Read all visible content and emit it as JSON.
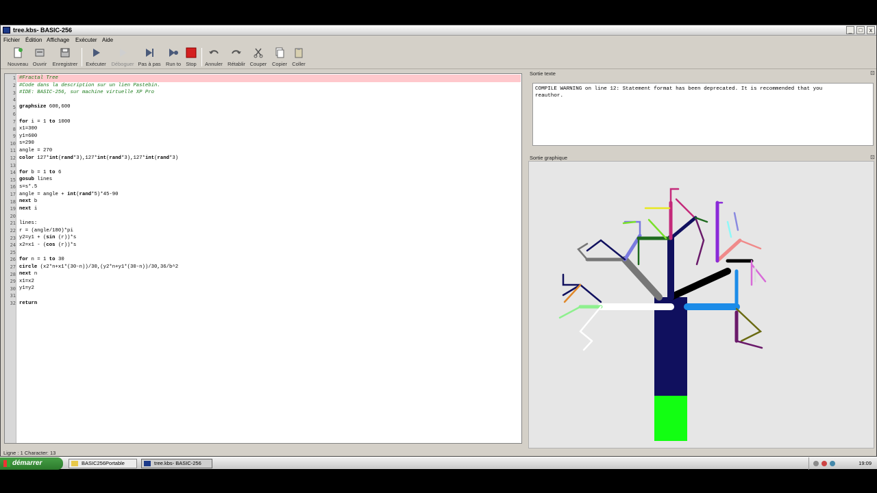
{
  "window": {
    "title": "tree.kbs- BASIC-256",
    "controls": {
      "minimize": "_",
      "maximize": "□",
      "close": "x"
    }
  },
  "menu": [
    "Fichier",
    "Édition",
    "Affichage",
    "Exécuter",
    "Aide"
  ],
  "toolbar": {
    "new": "Nouveau",
    "open": "Ouvrir",
    "save": "Enregistrer",
    "run": "Exécuter",
    "debug": "Déboguer",
    "step": "Pas à pas",
    "run_to": "Run to",
    "stop": "Stop",
    "undo": "Annuler",
    "redo": "Rétablir",
    "cut": "Couper",
    "copy": "Copier",
    "paste": "Coller"
  },
  "editor": {
    "line_numbers": [
      "1",
      "2",
      "3",
      "4",
      "5",
      "6",
      "7",
      "8",
      "9",
      "10",
      "11",
      "12",
      "13",
      "14",
      "15",
      "16",
      "17",
      "18",
      "19",
      "20",
      "21",
      "22",
      "23",
      "24",
      "25",
      "26",
      "27",
      "28",
      "29",
      "30",
      "31",
      "32"
    ]
  },
  "panels": {
    "text_output_title": "Sortie texte",
    "graphics_output_title": "Sortie graphique",
    "float_icon": "⊡",
    "text_output": "COMPILE WARNING on line 12: Statement format has been deprecated. It is recommended that you\nreauthor."
  },
  "status": "Ligne : 1 Character: 13",
  "taskbar": {
    "start": "démarrer",
    "tasks": [
      "BASIC256Portable",
      "tree.kbs- BASIC-256"
    ],
    "clock": "19:09"
  },
  "colors": {
    "line_highlight": "#ffc8cc",
    "comment": "#1a7a1a",
    "stop_button": "#d42020"
  }
}
